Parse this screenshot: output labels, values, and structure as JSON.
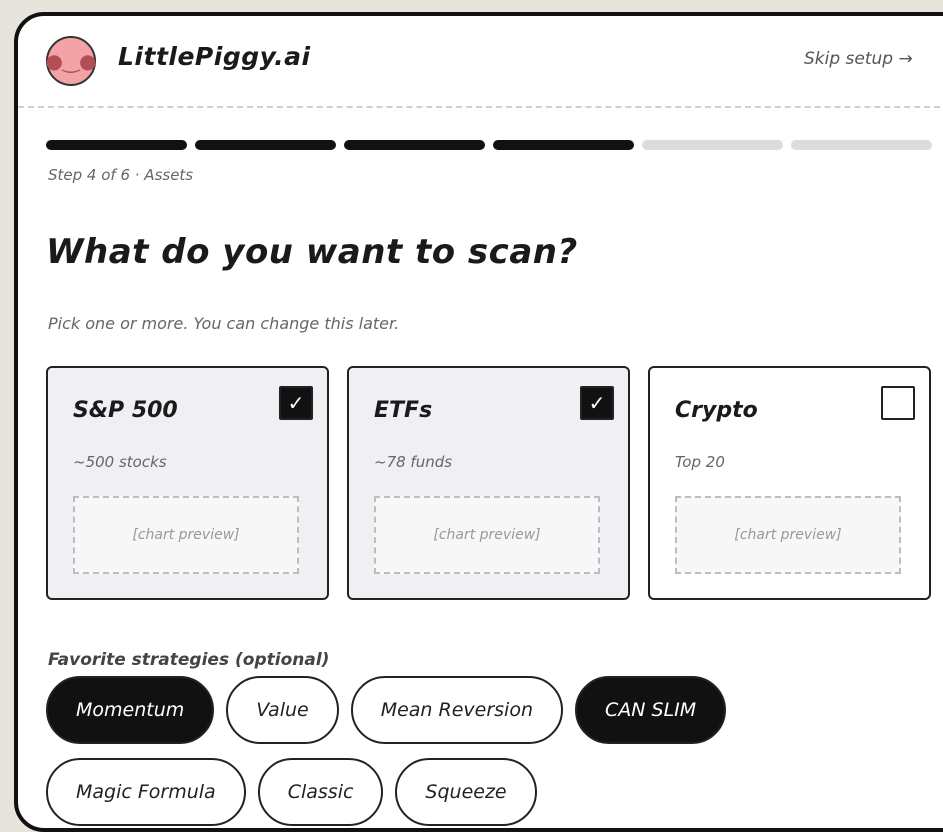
{
  "header": {
    "brand": "LittlePiggy.ai",
    "logo_icon": "pig-icon",
    "skip_label": "Skip setup →"
  },
  "progress": {
    "current_step": 4,
    "total_steps": 6,
    "step_label": "Step 4 of 6 · Assets"
  },
  "main": {
    "title": "What do you want to scan?",
    "subtitle": "Pick one or more. You can change this later."
  },
  "assets": [
    {
      "name": "S&P 500",
      "sub": "~500 stocks",
      "preview": "[chart preview]",
      "selected": true
    },
    {
      "name": "ETFs",
      "sub": "~78 funds",
      "preview": "[chart preview]",
      "selected": true
    },
    {
      "name": "Crypto",
      "sub": "Top 20",
      "preview": "[chart preview]",
      "selected": false
    }
  ],
  "strategies": {
    "label": "Favorite strategies (optional)",
    "items": [
      {
        "label": "Momentum",
        "selected": true
      },
      {
        "label": "Value",
        "selected": false
      },
      {
        "label": "Mean Reversion",
        "selected": false
      },
      {
        "label": "CAN SLIM",
        "selected": true
      },
      {
        "label": "Magic Formula",
        "selected": false
      },
      {
        "label": "Classic",
        "selected": false
      },
      {
        "label": "Squeeze",
        "selected": false
      }
    ]
  },
  "colors": {
    "accent": "#111111",
    "logo_bg": "#f3a3a5",
    "card_selected_bg": "#f0eff4"
  }
}
